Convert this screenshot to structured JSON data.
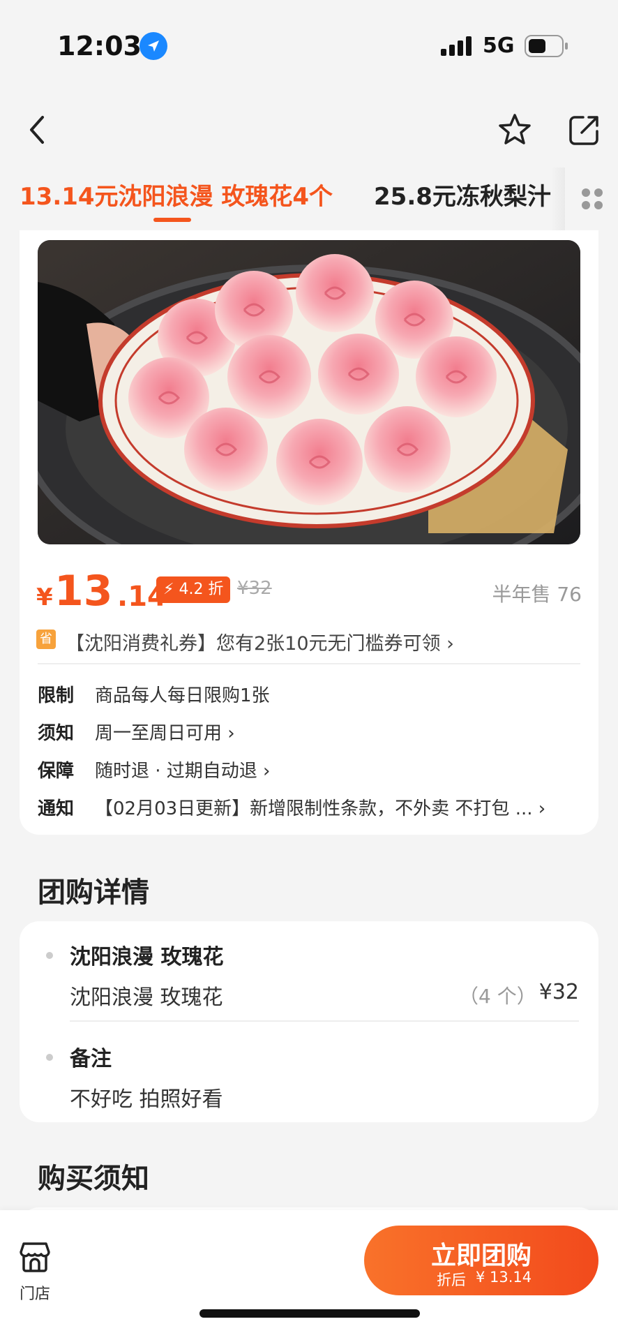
{
  "status_bar": {
    "time": "12:03",
    "network": "5G"
  },
  "tabs": [
    {
      "label": "13.14元沈阳浪漫 玫瑰花4个"
    },
    {
      "label": "25.8元冻秋梨汁"
    }
  ],
  "product": {
    "price_symbol": "¥",
    "price_integer": "13",
    "price_decimal": ".14",
    "discount": "4.2 折",
    "original_price": "¥32",
    "sold": "半年售 76",
    "coupon_icon": "省",
    "coupon_text": "【沈阳消费礼券】您有2张10元无门槛券可领 ›",
    "info": [
      {
        "label": "限制",
        "value": "商品每人每日限购1张"
      },
      {
        "label": "须知",
        "value": "周一至周日可用 ›"
      },
      {
        "label": "保障",
        "value": "随时退 · 过期自动退 ›"
      },
      {
        "label": "通知",
        "value": "【02月03日更新】新增限制性条款，不外卖 不打包 ... ›"
      }
    ]
  },
  "group_detail": {
    "title": "团购详情",
    "item_heading": "沈阳浪漫 玫瑰花",
    "item_name": "沈阳浪漫 玫瑰花",
    "item_qty": "（4 个）",
    "item_price": "¥32",
    "note_heading": "备注",
    "note_text": "不好吃 拍照好看"
  },
  "purchase_notice": {
    "title": "购买须知"
  },
  "bottom_bar": {
    "store_label": "门店",
    "buy_label": "立即团购",
    "buy_sub_prefix": "折后",
    "buy_sub_price": "¥ 13.14"
  },
  "colors": {
    "accent": "#f4551d",
    "background": "#f4f4f4",
    "card": "#ffffff"
  },
  "icons": [
    "location-arrow-icon",
    "signal-icon",
    "battery-icon",
    "back-icon",
    "star-icon",
    "share-icon",
    "grid-icon",
    "store-icon",
    "lightning-icon"
  ]
}
